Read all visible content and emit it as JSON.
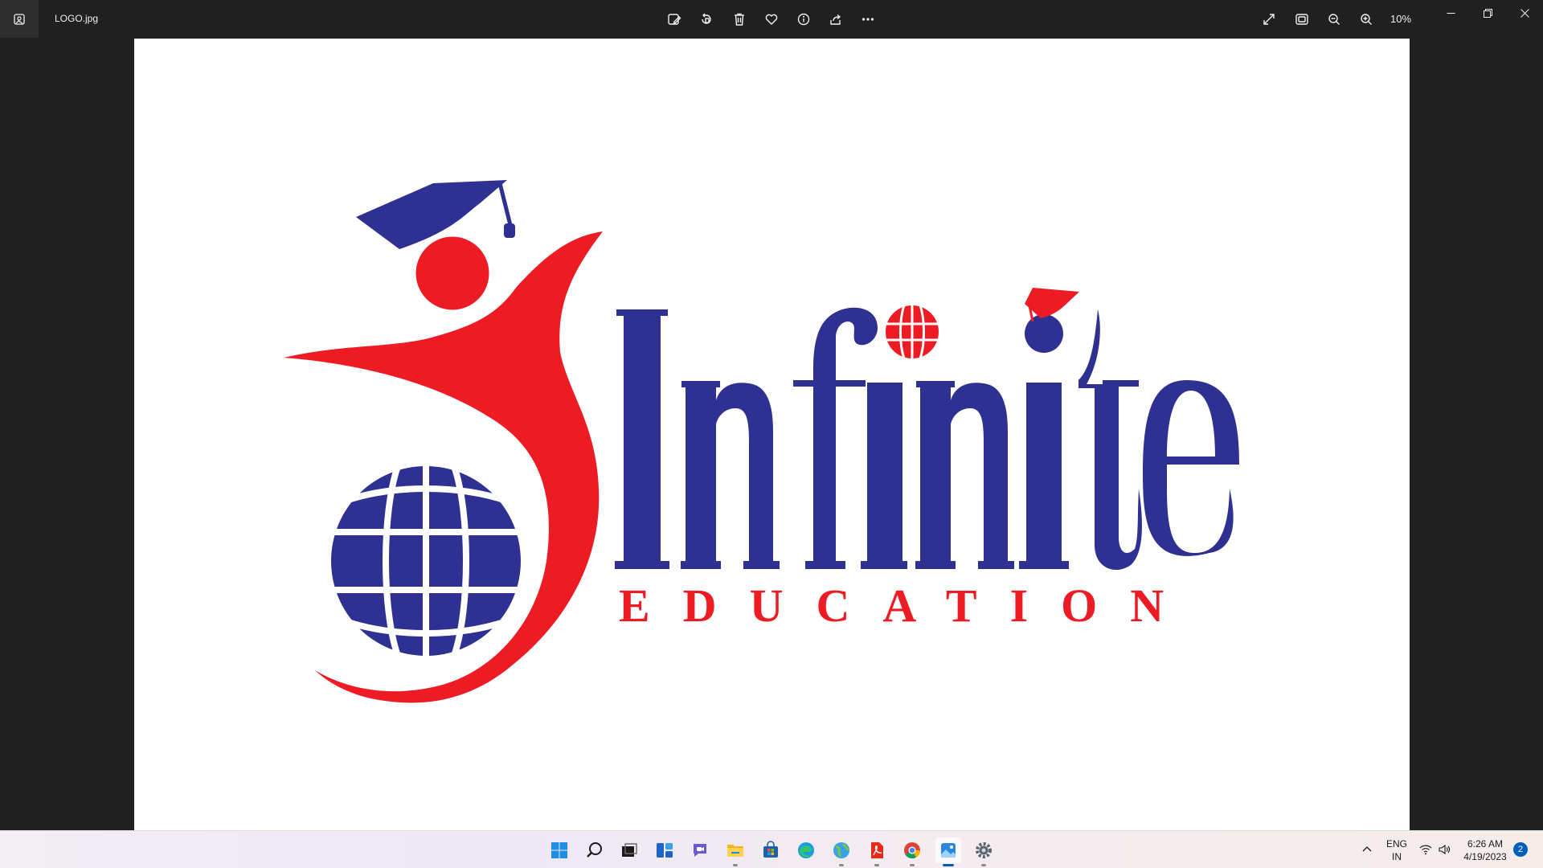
{
  "window": {
    "file_name": "LOGO.jpg",
    "zoom": "10%"
  },
  "toolbar": {
    "items": [
      "edit-image",
      "rotate",
      "delete",
      "favorite",
      "file-info",
      "share",
      "see-more"
    ],
    "right_items": [
      "full-screen",
      "fit-to-window",
      "zoom-out",
      "zoom-in"
    ]
  },
  "logo": {
    "brand_name": "Infinite",
    "tagline": "EDUCATION",
    "colors": {
      "blue": "#2e3192",
      "red": "#ed1c24"
    }
  },
  "taskbar": {
    "icons": [
      "start",
      "search",
      "task-view",
      "widgets",
      "chat",
      "file-explorer",
      "microsoft-store",
      "edge",
      "maps",
      "acrobat",
      "chrome",
      "photos",
      "settings"
    ]
  },
  "tray": {
    "language_line1": "ENG",
    "language_line2": "IN",
    "time": "6:26 AM",
    "date": "4/19/2023",
    "notification_count": "2"
  }
}
